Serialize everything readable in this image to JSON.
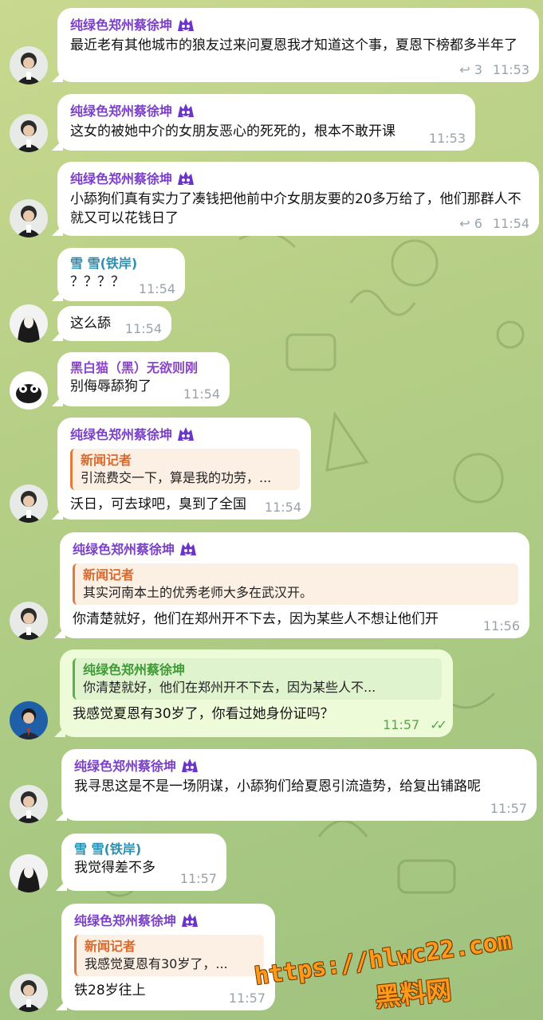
{
  "messages": [
    {
      "sender": "纯绿色郑州蔡徐坤",
      "text": "最近老有其他城市的狼友过来问夏恩我才知道这个事，夏恩下榜都多半年了",
      "replies": "3",
      "time": "11:53"
    },
    {
      "sender": "纯绿色郑州蔡徐坤",
      "text": "这女的被她中介的女朋友恶心的死死的，根本不敢开课",
      "time": "11:53"
    },
    {
      "sender": "纯绿色郑州蔡徐坤",
      "text": "小舔狗们真有实力了凑钱把他前中介女朋友要的20多万给了，他们那群人不就又可以花钱日了",
      "replies": "6",
      "time": "11:54"
    },
    {
      "sender": "雪 雪(铁岸)",
      "text": "？？？？",
      "time": "11:54"
    },
    {
      "text": "这么舔",
      "time": "11:54"
    },
    {
      "sender": "黑白猫（黑）无欲则刚",
      "text": "别侮辱舔狗了",
      "time": "11:54"
    },
    {
      "sender": "纯绿色郑州蔡徐坤",
      "quote_name": "新闻记者",
      "quote_text": "引流费交一下，算是我的功劳，...",
      "text": "沃日，可去球吧，臭到了全国",
      "time": "11:54"
    },
    {
      "sender": "纯绿色郑州蔡徐坤",
      "quote_name": "新闻记者",
      "quote_text": "其实河南本土的优秀老师大多在武汉开。",
      "text": "你清楚就好，他们在郑州开不下去，因为某些人不想让他们开",
      "time": "11:56"
    },
    {
      "quote_name": "纯绿色郑州蔡徐坤",
      "quote_text": "你清楚就好，他们在郑州开不下去，因为某些人不...",
      "text": "我感觉夏恩有30岁了，你看过她身份证吗？",
      "time": "11:57",
      "status": "✓✓"
    },
    {
      "sender": "纯绿色郑州蔡徐坤",
      "text": "我寻思这是不是一场阴谋，小舔狗们给夏恩引流造势，给复出铺路呢",
      "time": "11:57"
    },
    {
      "sender": "雪 雪(铁岸)",
      "text": "我觉得差不多",
      "time": "11:57"
    },
    {
      "sender": "纯绿色郑州蔡徐坤",
      "quote_name": "新闻记者",
      "quote_text": "我感觉夏恩有30岁了，...",
      "text": "铁28岁往上",
      "time": "11:57"
    }
  ],
  "watermark": {
    "line1": "https://hlwc22.com",
    "line2": "黑料网"
  },
  "colors": {
    "sender_purple": "#7b3fc9",
    "sender_teal": "#2c8fb0",
    "quote_orange": "#d9692c",
    "quote_green": "#3f9a35",
    "outgoing_bubble": "#eefbd9"
  }
}
